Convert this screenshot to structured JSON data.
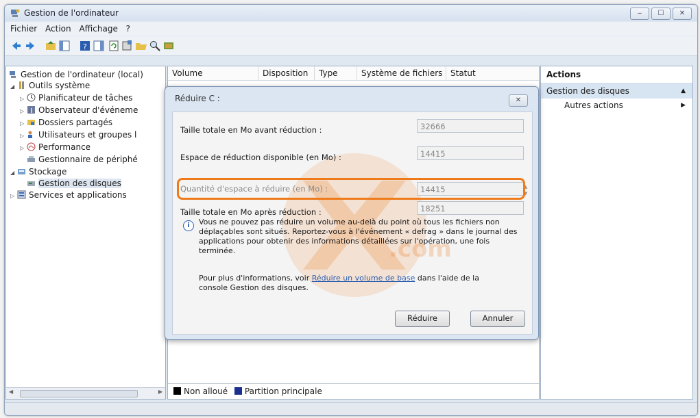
{
  "window": {
    "title": "Gestion de l'ordinateur",
    "controls": [
      "‒",
      "☐",
      "✕"
    ]
  },
  "menu": [
    "Fichier",
    "Action",
    "Affichage",
    "?"
  ],
  "tree": {
    "root": "Gestion de l'ordinateur (local)",
    "outils": "Outils système",
    "planificateur": "Planificateur de tâches",
    "observateur": "Observateur d'événeme",
    "dossiers": "Dossiers partagés",
    "utilisateurs": "Utilisateurs et groupes l",
    "performance": "Performance",
    "peripheriques": "Gestionnaire de périphé",
    "stockage": "Stockage",
    "disques": "Gestion des disques",
    "services": "Services et applications"
  },
  "columns": [
    "Volume",
    "Disposition",
    "Type",
    "Système de fichiers",
    "Statut"
  ],
  "legend": {
    "unallocated": "Non alloué",
    "primary": "Partition principale",
    "unallocated_color": "#000000",
    "primary_color": "#1a2f8f"
  },
  "actions": {
    "title": "Actions",
    "section": "Gestion des disques",
    "more": "Autres actions"
  },
  "dialog": {
    "title": "Réduire C :",
    "fields": [
      {
        "label": "Taille totale en Mo avant réduction :",
        "value": "32666"
      },
      {
        "label": "Espace de réduction disponible (en Mo) :",
        "value": "14415"
      },
      {
        "label": "Quantité d'espace à réduire (en Mo) :",
        "value": "14415"
      },
      {
        "label": "Taille totale en Mo après réduction :",
        "value": "18251"
      }
    ],
    "info": "Vous ne pouvez pas réduire un volume au-delà du point où tous les fichiers non déplaçables sont situés. Reportez-vous à l'événement « defrag » dans le journal des applications pour obtenir des informations détaillées sur l'opération, une fois terminée.",
    "more_prefix": "Pour plus d'informations, voir ",
    "more_link": "Réduire un volume de base",
    "more_suffix": " dans l'aide de la console Gestion des disques.",
    "shrink_button": "Réduire",
    "cancel_button": "Annuler",
    "highlight_color": "#ee7a1a"
  },
  "watermark": {
    "text": ".com"
  }
}
